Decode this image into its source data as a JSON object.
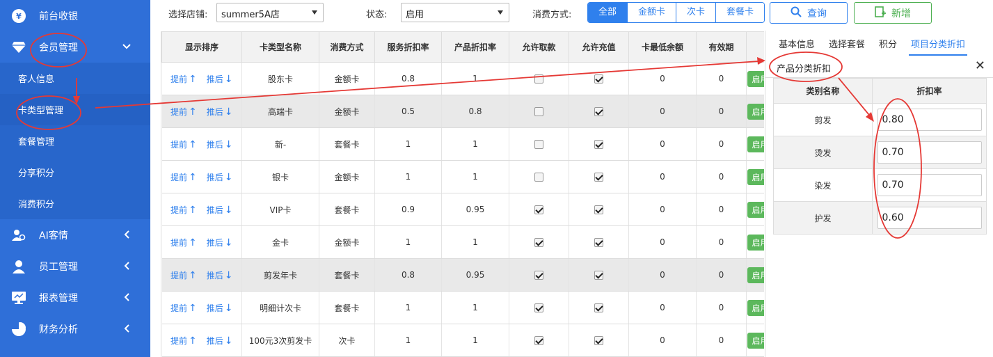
{
  "sidebar": {
    "items_top": [
      {
        "label": "前台收银",
        "icon": "yen-icon"
      },
      {
        "label": "会员管理",
        "icon": "diamond-icon"
      }
    ],
    "submenu": [
      "客人信息",
      "卡类型管理",
      "套餐管理",
      "分享积分",
      "消费积分"
    ],
    "items_bottom": [
      {
        "label": "AI客情",
        "icon": "users-icon"
      },
      {
        "label": "员工管理",
        "icon": "user-icon"
      },
      {
        "label": "报表管理",
        "icon": "monitor-icon"
      },
      {
        "label": "财务分析",
        "icon": "pie-icon"
      }
    ]
  },
  "filter": {
    "store_label": "选择店铺:",
    "store_value": "summer5A店",
    "status_label": "状态:",
    "status_value": "启用",
    "pay_label": "消费方式:",
    "pay_options": [
      "全部",
      "金额卡",
      "次卡",
      "套餐卡"
    ],
    "query_label": "查询",
    "add_label": "新增"
  },
  "table": {
    "headers": [
      "显示排序",
      "卡类型名称",
      "消费方式",
      "服务折扣率",
      "产品折扣率",
      "允许取款",
      "允许充值",
      "卡最低余额",
      "有效期",
      ""
    ],
    "move_up": "提前",
    "move_down": "推后",
    "enable_label": "启用",
    "rows": [
      {
        "name": "股东卡",
        "pay": "金额卡",
        "service": "0.8",
        "product": "1",
        "withdraw": false,
        "recharge": true,
        "min": "0",
        "valid": "0"
      },
      {
        "name": "高端卡",
        "pay": "金额卡",
        "service": "0.5",
        "product": "0.8",
        "withdraw": false,
        "recharge": true,
        "min": "0",
        "valid": "0"
      },
      {
        "name": "新-",
        "pay": "套餐卡",
        "service": "1",
        "product": "1",
        "withdraw": false,
        "recharge": true,
        "min": "0",
        "valid": "0"
      },
      {
        "name": "银卡",
        "pay": "金额卡",
        "service": "1",
        "product": "1",
        "withdraw": false,
        "recharge": true,
        "min": "0",
        "valid": "0"
      },
      {
        "name": "VIP卡",
        "pay": "套餐卡",
        "service": "0.9",
        "product": "0.95",
        "withdraw": true,
        "recharge": true,
        "min": "0",
        "valid": "0"
      },
      {
        "name": "金卡",
        "pay": "金额卡",
        "service": "1",
        "product": "1",
        "withdraw": true,
        "recharge": true,
        "min": "0",
        "valid": "0"
      },
      {
        "name": "剪发年卡",
        "pay": "套餐卡",
        "service": "0.8",
        "product": "0.95",
        "withdraw": true,
        "recharge": true,
        "min": "0",
        "valid": "0"
      },
      {
        "name": "明细计次卡",
        "pay": "套餐卡",
        "service": "1",
        "product": "1",
        "withdraw": true,
        "recharge": true,
        "min": "0",
        "valid": "0"
      },
      {
        "name": "100元3次剪发卡",
        "pay": "次卡",
        "service": "1",
        "product": "1",
        "withdraw": true,
        "recharge": true,
        "min": "0",
        "valid": "0"
      }
    ]
  },
  "panel": {
    "tabs": [
      "基本信息",
      "选择套餐",
      "积分",
      "项目分类折扣"
    ],
    "title": "产品分类折扣",
    "close": "✕",
    "headers": [
      "类别名称",
      "折扣率"
    ],
    "rows": [
      {
        "name": "剪发",
        "rate": "0.80"
      },
      {
        "name": "烫发",
        "rate": "0.70"
      },
      {
        "name": "染发",
        "rate": "0.70"
      },
      {
        "name": "护发",
        "rate": "0.60"
      }
    ]
  },
  "colors": {
    "sidebar": "#2f6fd8",
    "accent": "#2f80ed",
    "success": "#4caf50",
    "annotation": "#e53935"
  }
}
